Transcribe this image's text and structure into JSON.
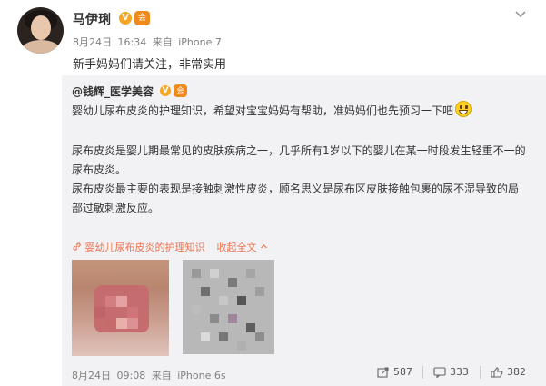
{
  "post": {
    "author": "马伊琍",
    "verified_badge": "V",
    "vip_badge": "会",
    "date": "8月24日",
    "time": "16:34",
    "source_prefix": "来自",
    "source": "iPhone 7",
    "text": "新手妈妈们请关注，非常实用",
    "menu_icon": "chevron-down-icon"
  },
  "retweet": {
    "author": "@钱辉_医学美容",
    "verified_badge": "V",
    "vip_badge": "会",
    "lines": [
      "婴幼儿尿布皮炎的护理知识，希望对宝宝妈妈有帮助，准妈妈们也先预习一下吧",
      "尿布皮炎是婴儿期最常见的皮肤疾病之一，几乎所有1岁以下的婴儿在某一时段发生轻重不一的",
      "尿布皮炎。",
      "尿布皮炎最主要的表现是接触刺激性皮炎，顾名思义是尿布区皮肤接触包裹的尿不湿导致的局",
      "部过敏刺激反应。"
    ],
    "emoji": "grinning-emoji",
    "article_link": "婴幼儿尿布皮炎的护理知识",
    "collapse_label": "收起全文",
    "date": "8月24日",
    "time": "09:08",
    "source_prefix": "来自",
    "source": "iPhone 6s",
    "forwards": "587",
    "comments": "333",
    "likes": "382"
  },
  "colors": {
    "link": "#eb7350",
    "retweet_bg": "#f2f2f5",
    "badge": "#f6a623"
  }
}
